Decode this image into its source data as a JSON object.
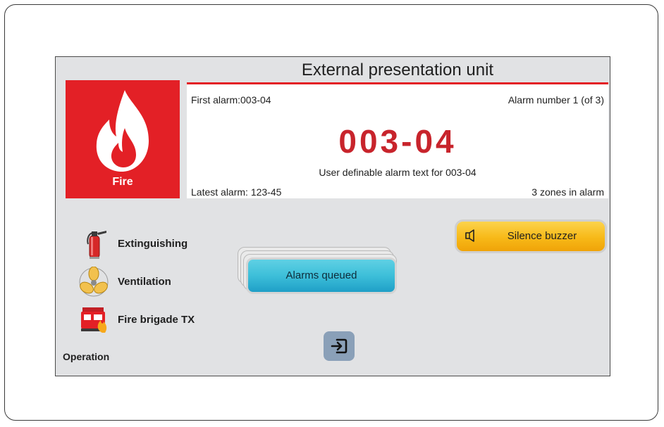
{
  "header": {
    "title": "External presentation unit"
  },
  "fire_tile": {
    "label": "Fire"
  },
  "alarm": {
    "first_alarm": "First alarm:003-04",
    "alarm_number": "Alarm number 1 (of 3)",
    "code": "003-04",
    "text": "User definable alarm text for 003-04",
    "latest_alarm": "Latest alarm: 123-45",
    "zones": "3 zones in alarm"
  },
  "operation": {
    "items": [
      {
        "label": "Extinguishing",
        "icon": "fire-extinguisher-icon"
      },
      {
        "label": "Ventilation",
        "icon": "fan-icon"
      },
      {
        "label": "Fire brigade TX",
        "icon": "fire-truck-icon"
      }
    ],
    "label": "Operation"
  },
  "buttons": {
    "alarms_queued": "Alarms queued",
    "silence_buzzer": "Silence buzzer"
  },
  "colors": {
    "fire_red": "#e32026",
    "code_red": "#c8242c",
    "queued_blue": "#3dbfd9",
    "silence_yellow": "#f7b918",
    "screen_bg": "#e1e2e4"
  }
}
